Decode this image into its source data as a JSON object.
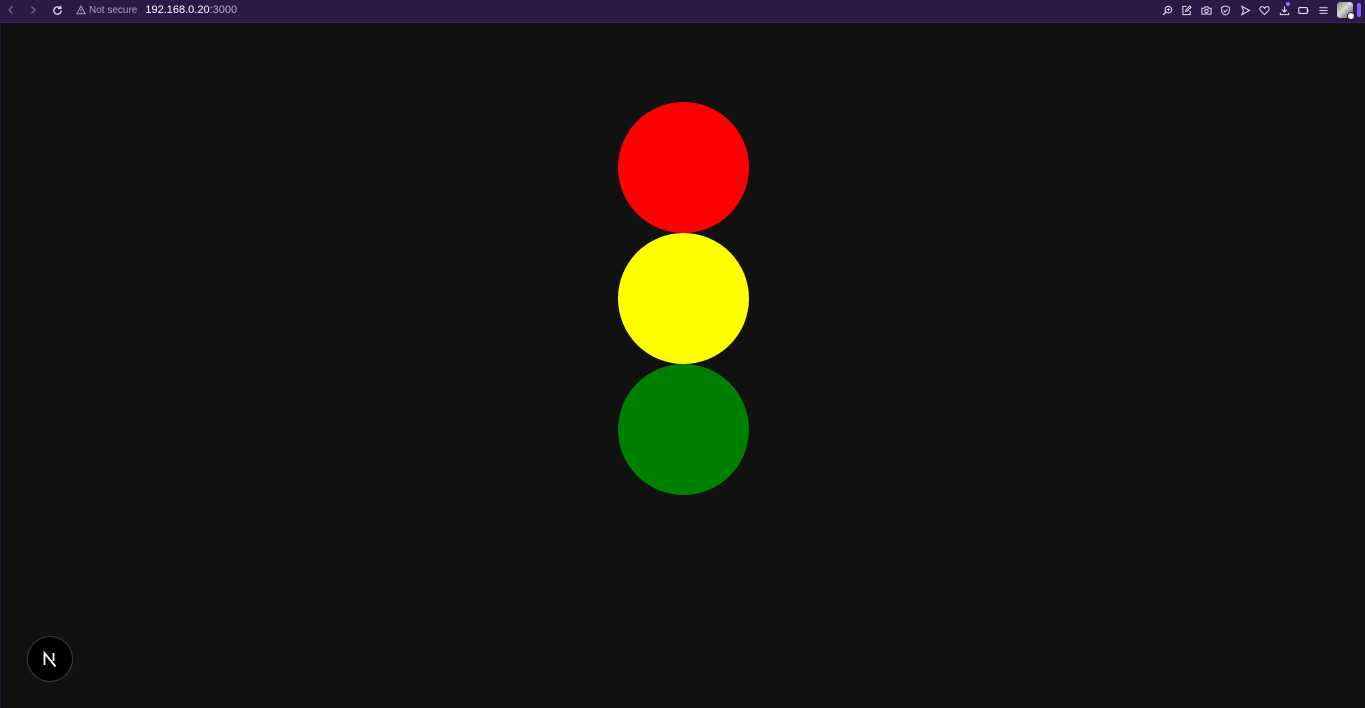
{
  "browser": {
    "security_label": "Not secure",
    "url_host": "192.168.0.20",
    "url_port": ":3000",
    "icons": [
      "back-icon",
      "forward-icon",
      "reload-icon",
      "warning-icon",
      "zoom-icon",
      "edit-icon",
      "camera-icon",
      "shield-icon",
      "send-icon",
      "heart-icon",
      "download-icon",
      "battery-icon",
      "menu-icon"
    ]
  },
  "traffic_light": {
    "lights": [
      {
        "name": "red",
        "color": "#ff0000"
      },
      {
        "name": "yellow",
        "color": "#ffff00"
      },
      {
        "name": "green",
        "color": "#008000"
      }
    ]
  },
  "next_badge": {
    "letter": "N"
  },
  "colors": {
    "page_background": "#111111",
    "toolbar_background": "#2a1a47",
    "accent": "#8a5cff"
  }
}
